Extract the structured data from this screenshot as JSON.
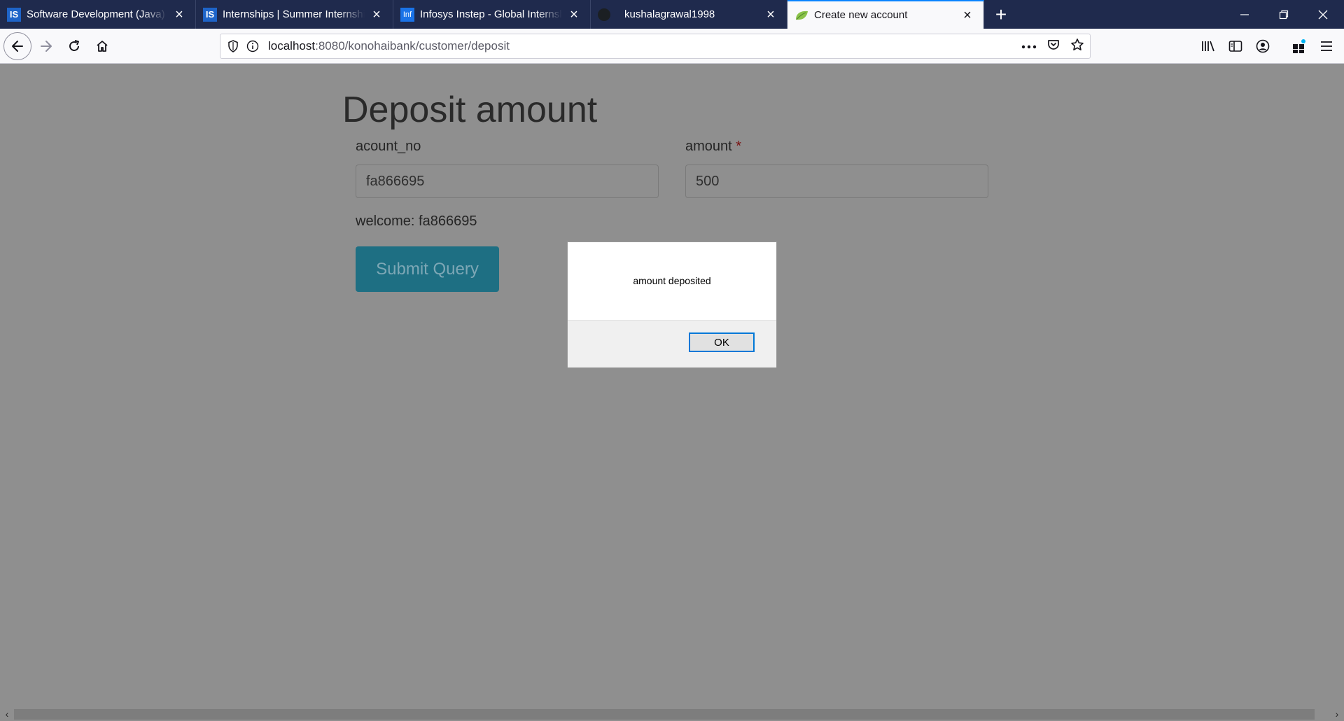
{
  "tabs": [
    {
      "title": "Software Development (Java) w",
      "favicon": "is-logo-icon",
      "active": false
    },
    {
      "title": "Internships | Summer Internship",
      "favicon": "is-logo-icon",
      "active": false
    },
    {
      "title": "Infosys Instep - Global Internsh",
      "favicon": "infosys-logo-icon",
      "active": false
    },
    {
      "title": "kushalagrawal1998",
      "favicon": "github-icon",
      "active": false
    },
    {
      "title": "Create new account",
      "favicon": "spring-leaf-icon",
      "active": true
    }
  ],
  "url": {
    "host": "localhost",
    "path": ":8080/konohaibank/customer/deposit"
  },
  "page": {
    "title": "Deposit amount",
    "account_label": "acount_no",
    "account_value": "fa866695",
    "amount_label": "amount",
    "required_mark": "*",
    "amount_value": "500",
    "welcome_text": "welcome: fa866695",
    "submit_label": "Submit Query"
  },
  "dialog": {
    "message": "amount deposited",
    "ok_label": "OK"
  },
  "colors": {
    "tabbar": "#1f2a4d",
    "active_tab_accent": "#0a84ff",
    "overlay_gray": "#8f8f8f",
    "submit_button": "#1e6f83",
    "dialog_focus": "#0078d7"
  },
  "icons": {
    "scroll_left": "‹",
    "scroll_right": "›"
  }
}
